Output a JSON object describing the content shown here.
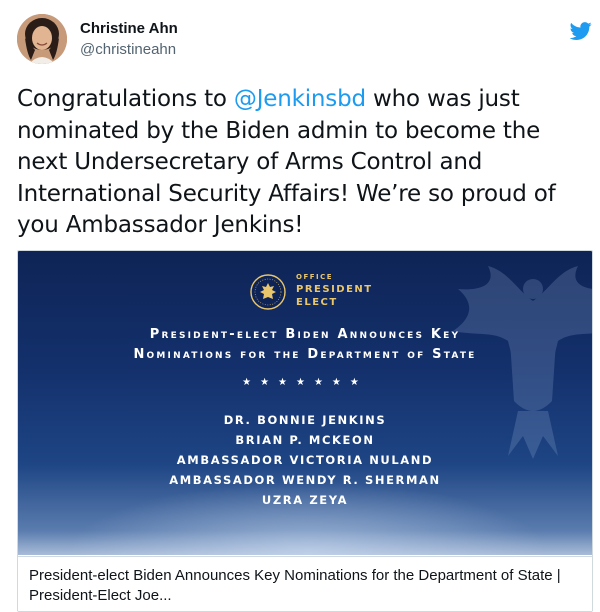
{
  "author": {
    "name": "Christine Ahn",
    "handle": "@christineahn"
  },
  "tweet": {
    "text_before": "Congratulations to ",
    "mention": "@Jenkinsbd",
    "text_after": " who was just nominated by the Biden admin to become the next Undersecretary of Arms Control and International Security Affairs! We’re so proud of you Ambassador Jenkins!"
  },
  "card": {
    "office_line1": "OFFICE",
    "office_line2": "PRESIDENT",
    "office_line3": "ELECT",
    "headline_line1": "President-elect Biden Announces Key",
    "headline_line2": "Nominations for the Department of State",
    "stars": "★★★★★★★",
    "nominees": [
      "DR. BONNIE JENKINS",
      "BRIAN P. MCKEON",
      "AMBASSADOR VICTORIA NULAND",
      "AMBASSADOR WENDY R. SHERMAN",
      "UZRA ZEYA"
    ],
    "title": "President-elect Biden Announces Key Nominations for the Department of State | President-Elect Joe..."
  },
  "colors": {
    "accent": "#1d9bf0",
    "text": "#0f1419",
    "muted": "#536471",
    "card_bg": "#14316d",
    "gold": "#e9c66c"
  },
  "icons": {
    "logo": "twitter-bird-icon",
    "seal": "presidential-seal-icon"
  }
}
